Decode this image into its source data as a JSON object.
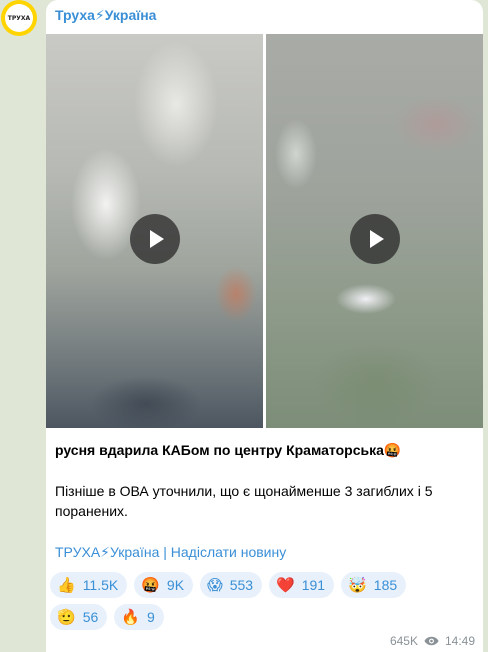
{
  "channel": {
    "name": "Труха⚡Україна",
    "avatar_text": "ТРУХА"
  },
  "post": {
    "headline": "русня вдарила КАБом по центру Краматорська🤬",
    "body": "Пізніше в ОВА уточнили, що є щонайменше 3 загиблих і 5 поранених.",
    "link_text": "ТРУХА⚡Україна | Надіслати новину"
  },
  "media": {
    "videos": [
      {
        "type": "video",
        "icon": "play-icon"
      },
      {
        "type": "video",
        "icon": "play-icon"
      }
    ]
  },
  "reactions": [
    {
      "emoji": "👍",
      "count": "11.5K"
    },
    {
      "emoji": "🤬",
      "count": "9K"
    },
    {
      "emoji": "😱",
      "count": "553"
    },
    {
      "emoji": "❤️",
      "count": "191"
    },
    {
      "emoji": "🤯",
      "count": "185"
    },
    {
      "emoji": "🫡",
      "count": "56"
    },
    {
      "emoji": "🔥",
      "count": "9"
    }
  ],
  "meta": {
    "views": "645K",
    "time": "14:49"
  },
  "colors": {
    "link": "#3a8fd6",
    "avatar_ring": "#ffd400",
    "reaction_bg": "#e8f1fb"
  }
}
